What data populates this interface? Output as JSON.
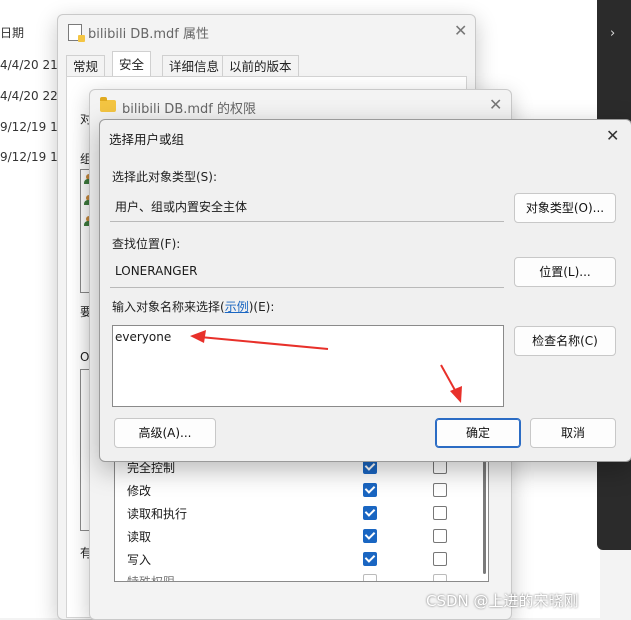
{
  "explorer": {
    "date_header": "日期",
    "dates": [
      "4/4/20 21:",
      "4/4/20 22:",
      "9/12/19 1",
      "9/12/19 1"
    ]
  },
  "properties_window": {
    "title": "bilibili DB.mdf 属性",
    "tabs": [
      "常规",
      "安全",
      "详细信息",
      "以前的版本"
    ],
    "active_tab": "安全",
    "fragments": [
      "对",
      "组",
      "要",
      "O",
      "有"
    ]
  },
  "permissions_window": {
    "title": "bilibili DB.mdf 的权限",
    "permissions": [
      {
        "label": "完全控制",
        "allow": true,
        "deny": false
      },
      {
        "label": "修改",
        "allow": true,
        "deny": false
      },
      {
        "label": "读取和执行",
        "allow": true,
        "deny": false
      },
      {
        "label": "读取",
        "allow": true,
        "deny": false
      },
      {
        "label": "写入",
        "allow": true,
        "deny": false
      },
      {
        "label": "特殊权限",
        "allow": false,
        "deny": false
      }
    ]
  },
  "select_dialog": {
    "title": "选择用户或组",
    "object_type_label": "选择此对象类型(S):",
    "object_type_value": "用户、组或内置安全主体",
    "object_type_button": "对象类型(O)...",
    "location_label": "查找位置(F):",
    "location_value": "LONERANGER",
    "location_button": "位置(L)...",
    "names_label_prefix": "输入对象名称来选择(",
    "names_label_link": "示例",
    "names_label_suffix": ")(E):",
    "names_value": "everyone",
    "check_names_button": "检查名称(C)",
    "advanced_button": "高级(A)...",
    "ok_button": "确定",
    "cancel_button": "取消"
  },
  "watermark": "CSDN @上进的宋晓刚",
  "colors": {
    "accent": "#1a66c2",
    "annotation_arrow": "#e8302a"
  }
}
